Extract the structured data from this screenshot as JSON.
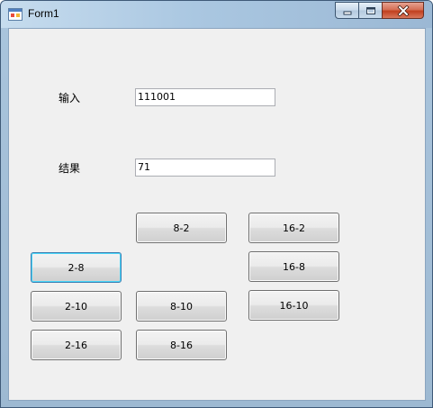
{
  "window": {
    "title": "Form1"
  },
  "form": {
    "input_label": "输入",
    "input_value": "111001",
    "result_label": "结果",
    "result_value": "71"
  },
  "buttons": {
    "b8_2": "8-2",
    "b16_2": "16-2",
    "b2_8": "2-8",
    "b16_8": "16-8",
    "b2_10": "2-10",
    "b8_10": "8-10",
    "b16_10": "16-10",
    "b2_16": "2-16",
    "b8_16": "8-16"
  },
  "colors": {
    "titlebar": "#aac7e1",
    "client_background": "#f0f0f0",
    "close_button": "#c1401f",
    "focus_border": "#3c7fb1"
  },
  "focused_button": "2-8"
}
